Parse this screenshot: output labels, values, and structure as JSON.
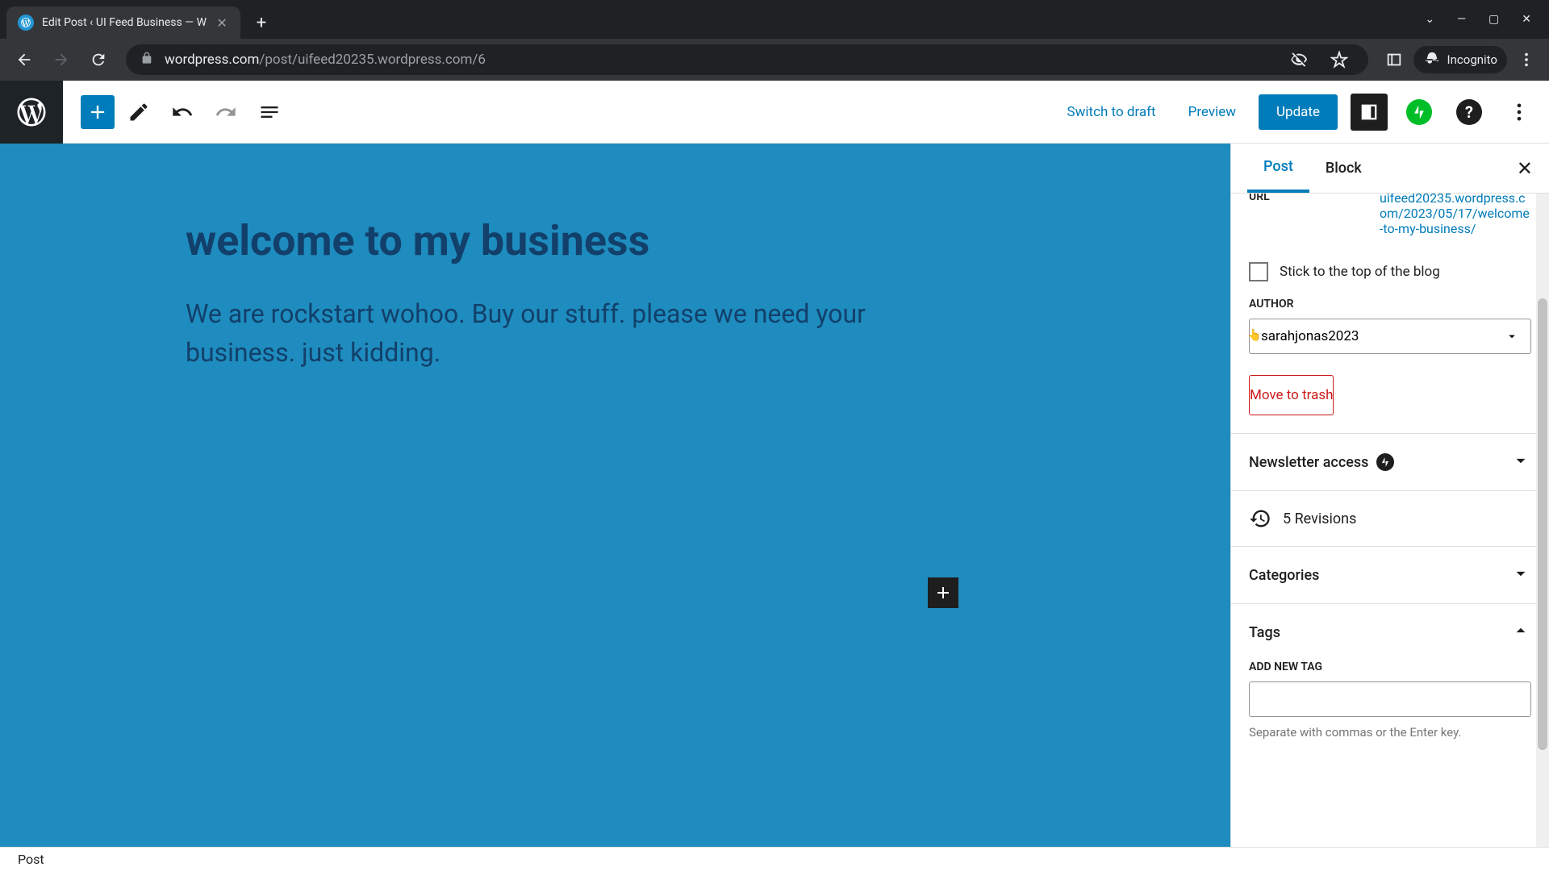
{
  "browser": {
    "tab_title": "Edit Post ‹ UI Feed Business — W",
    "url_domain": "wordpress.com",
    "url_path": "/post/uifeed20235.wordpress.com/6",
    "incognito_label": "Incognito"
  },
  "toolbar": {
    "switch_draft": "Switch to draft",
    "preview": "Preview",
    "update": "Update"
  },
  "content": {
    "title": "welcome to my business",
    "body": "We are rockstart wohoo. Buy our stuff. please we need your business. just kidding."
  },
  "sidebar": {
    "tabs": {
      "post": "Post",
      "block": "Block"
    },
    "url_label": "URL",
    "url_value": "uifeed20235.wordpress.com/2023/05/17/welcome-to-my-business/",
    "sticky_label": "Stick to the top of the blog",
    "author_label": "AUTHOR",
    "author_value": "sarahjonas2023",
    "trash_label": "Move to trash",
    "newsletter_label": "Newsletter access",
    "revisions_label": "5 Revisions",
    "categories_label": "Categories",
    "tags_label": "Tags",
    "add_tag_label": "ADD NEW TAG",
    "tag_hint": "Separate with commas or the Enter key."
  },
  "status": "Post"
}
